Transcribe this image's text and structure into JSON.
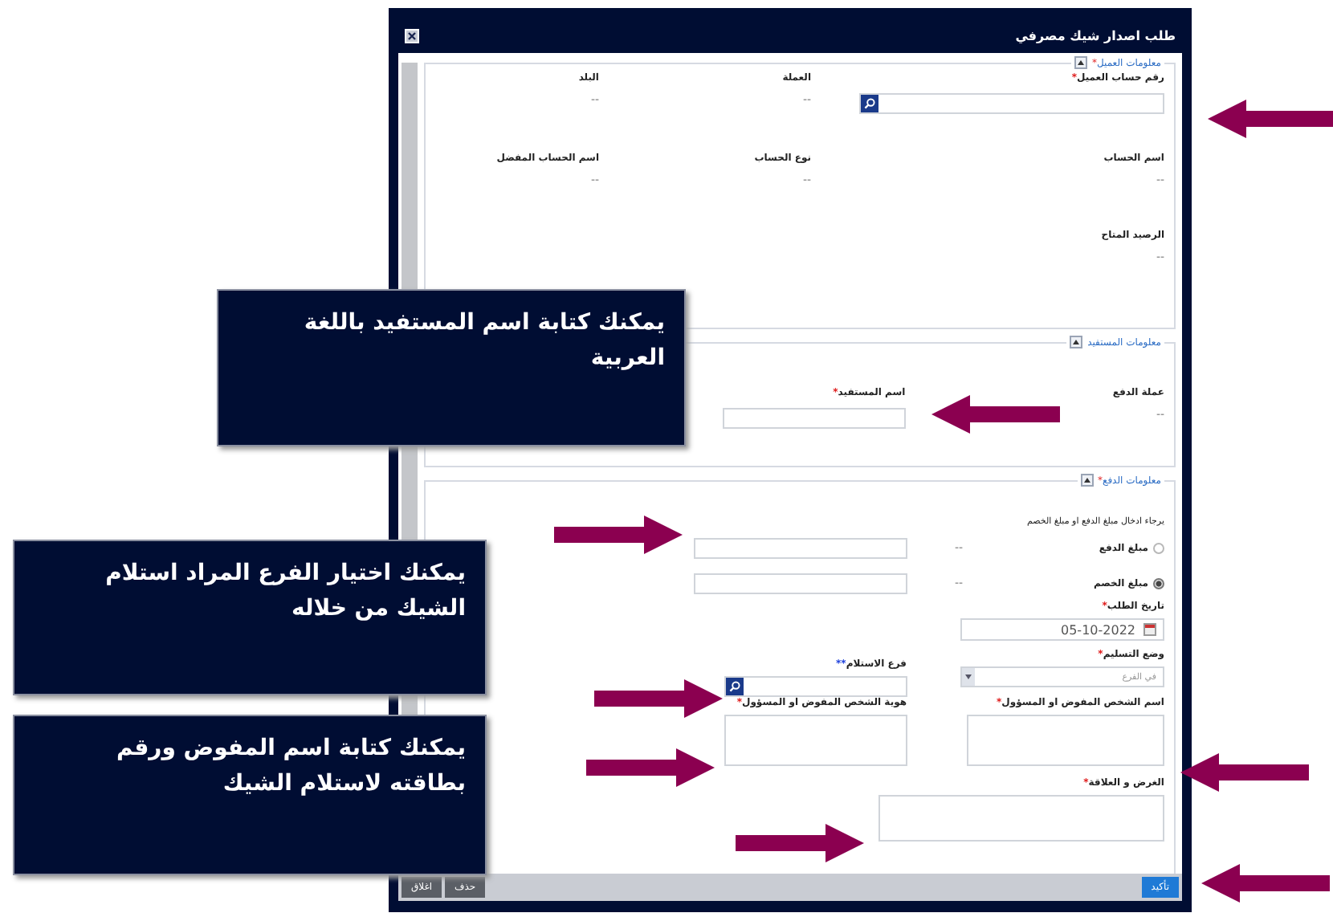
{
  "window": {
    "title": "طلب اصدار شيك مصرفي"
  },
  "customer_info": {
    "title": "معلومات العميل",
    "mark": "*",
    "expanded": true,
    "account_number": {
      "label": "رقم حساب العميل",
      "mark": "*"
    },
    "currency": {
      "label": "العملة",
      "value": "--"
    },
    "country": {
      "label": "البلد",
      "value": "--"
    },
    "account_name": {
      "label": "اسم الحساب",
      "value": "--"
    },
    "account_type": {
      "label": "نوع الحساب",
      "value": "--"
    },
    "preferred_name": {
      "label": "اسم الحساب المفضل",
      "value": "--"
    },
    "available_balance": {
      "label": "الرصيد المتاح",
      "value": "--"
    }
  },
  "beneficiary_info": {
    "title": "معلومات المستفيد",
    "expanded": true,
    "payment_currency": {
      "label": "عملة الدفع",
      "value": "--"
    },
    "beneficiary_name": {
      "label": "اسم المستفيد",
      "mark": "*"
    }
  },
  "payment_info": {
    "title": "معلومات الدفع",
    "mark": "*",
    "expanded": true,
    "hint": "يرجاء ادخال مبلغ الدفع او مبلغ الخصم",
    "amount_options": [
      {
        "label": "مبلغ الدفع",
        "selected": false,
        "value": "--"
      },
      {
        "label": "مبلغ الخصم",
        "selected": true,
        "value": "--"
      }
    ],
    "request_date": {
      "label": "تاريخ الطلب",
      "mark": "*",
      "value": "05-10-2022"
    },
    "delivery_mode": {
      "label": "وضع التسليم",
      "mark": "*",
      "placeholder": "في الفرع"
    },
    "pickup_branch": {
      "label": "فرع الاستلام",
      "mark": "**"
    },
    "authorized_name": {
      "label": "اسم الشخص المفوض او المسؤول",
      "mark": "*"
    },
    "authorized_id": {
      "label": "هوية الشخص المفوض او المسؤول",
      "mark": "*"
    },
    "purpose": {
      "label": "الغرض و العلاقة",
      "mark": "*"
    }
  },
  "footer": {
    "buttons": [
      {
        "label": "تأكيد",
        "kind": "primary"
      },
      {
        "label": "حذف",
        "kind": "secondary"
      },
      {
        "label": "اغلاق",
        "kind": "secondary"
      }
    ]
  },
  "callouts": [
    {
      "text": "يمكنك كتابة اسم المستفيد باللغة العربية"
    },
    {
      "text": "يمكنك اختيار الفرع المراد استلام الشيك من خلاله"
    },
    {
      "text": "يمكنك كتابة اسم المفوض ورقم بطاقته لاستلام الشيك"
    }
  ]
}
